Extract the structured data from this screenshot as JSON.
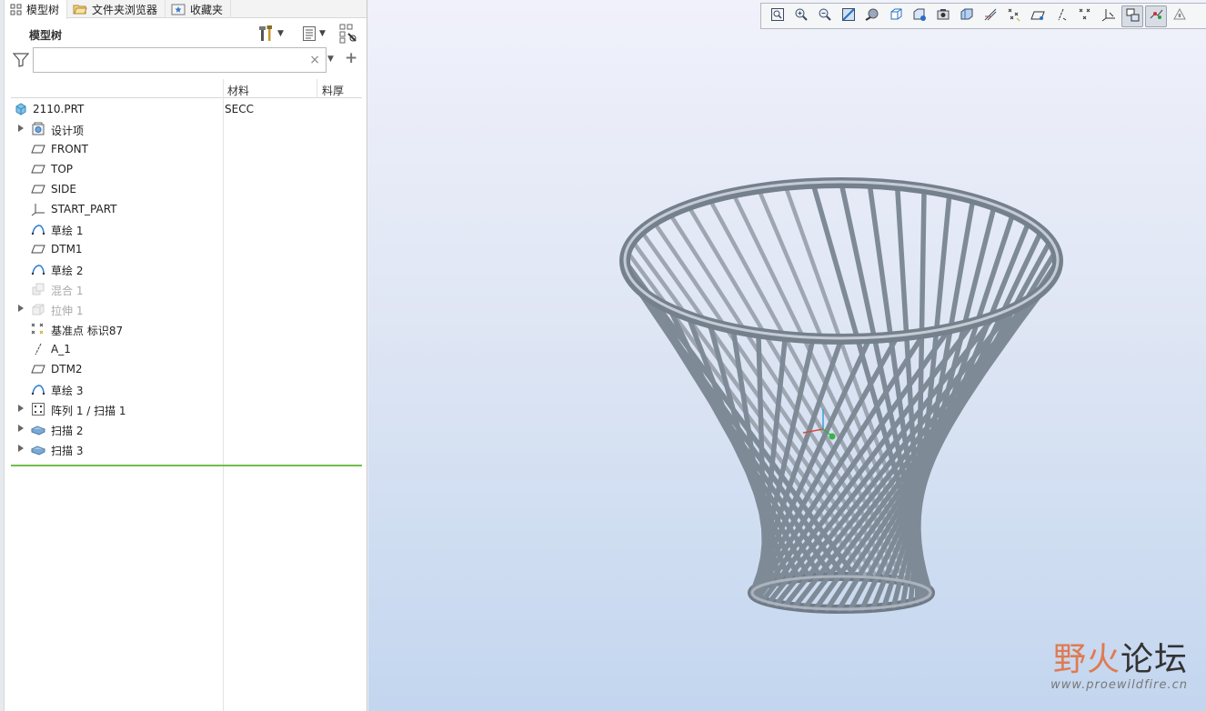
{
  "tabs": [
    {
      "label": "模型树",
      "icon": "model-tree-icon",
      "active": true
    },
    {
      "label": "文件夹浏览器",
      "icon": "folder-browser-icon",
      "active": false
    },
    {
      "label": "收藏夹",
      "icon": "favorites-icon",
      "active": false
    }
  ],
  "tree_panel": {
    "title": "模型树",
    "search_value": "",
    "search_placeholder": "",
    "clear_glyph": "×",
    "add_glyph": "+"
  },
  "columns": {
    "material": "材料",
    "thickness": "料厚"
  },
  "tree": {
    "root": {
      "label": "2110.PRT",
      "material": "SECC",
      "icon": "part-icon"
    },
    "items": [
      {
        "label": "设计项",
        "icon": "design-items-icon",
        "expandable": true,
        "suppressed": false
      },
      {
        "label": "FRONT",
        "icon": "datum-plane-icon",
        "expandable": false,
        "suppressed": false
      },
      {
        "label": "TOP",
        "icon": "datum-plane-icon",
        "expandable": false,
        "suppressed": false
      },
      {
        "label": "SIDE",
        "icon": "datum-plane-icon",
        "expandable": false,
        "suppressed": false
      },
      {
        "label": "START_PART",
        "icon": "coordinate-system-icon",
        "expandable": false,
        "suppressed": false
      },
      {
        "label": "草绘 1",
        "icon": "sketch-icon",
        "expandable": false,
        "suppressed": false
      },
      {
        "label": "DTM1",
        "icon": "datum-plane-icon",
        "expandable": false,
        "suppressed": false
      },
      {
        "label": "草绘 2",
        "icon": "sketch-icon",
        "expandable": false,
        "suppressed": false
      },
      {
        "label": "混合 1",
        "icon": "blend-icon",
        "expandable": false,
        "suppressed": true
      },
      {
        "label": "拉伸 1",
        "icon": "extrude-icon",
        "expandable": true,
        "suppressed": true
      },
      {
        "label": "基准点 标识87",
        "icon": "datum-point-icon",
        "expandable": false,
        "suppressed": false
      },
      {
        "label": "A_1",
        "icon": "datum-axis-icon",
        "expandable": false,
        "suppressed": false
      },
      {
        "label": "DTM2",
        "icon": "datum-plane-icon",
        "expandable": false,
        "suppressed": false
      },
      {
        "label": "草绘 3",
        "icon": "sketch-icon",
        "expandable": false,
        "suppressed": false
      },
      {
        "label": "阵列 1 / 扫描 1",
        "icon": "pattern-icon",
        "expandable": true,
        "suppressed": false
      },
      {
        "label": "扫描 2",
        "icon": "sweep-icon",
        "expandable": true,
        "suppressed": false
      },
      {
        "label": "扫描 3",
        "icon": "sweep-icon",
        "expandable": true,
        "suppressed": false
      }
    ]
  },
  "view_toolbar": [
    "refit-icon",
    "zoom-in-icon",
    "zoom-out-icon",
    "repaint-icon",
    "render-style-icon",
    "saved-orientations-icon",
    "view-manager-icon",
    "perspective-icon",
    "section-icon",
    "annotation-display-icon",
    "datum-plane-display-icon",
    "axis-display-icon",
    "point-display-icon",
    "csys-display-icon",
    "spin-center-icon",
    "model-highlight-icon",
    "display-style-icon",
    "pause-icon"
  ],
  "watermark": {
    "brand": "野火论坛",
    "brand_accent": "野火",
    "brand_rest": "论坛",
    "url": "www.proewildfire.cn"
  },
  "colors": {
    "accent_green": "#6fbf4a",
    "model_gray": "#8e98a4",
    "watermark_orange": "#e07a50"
  }
}
